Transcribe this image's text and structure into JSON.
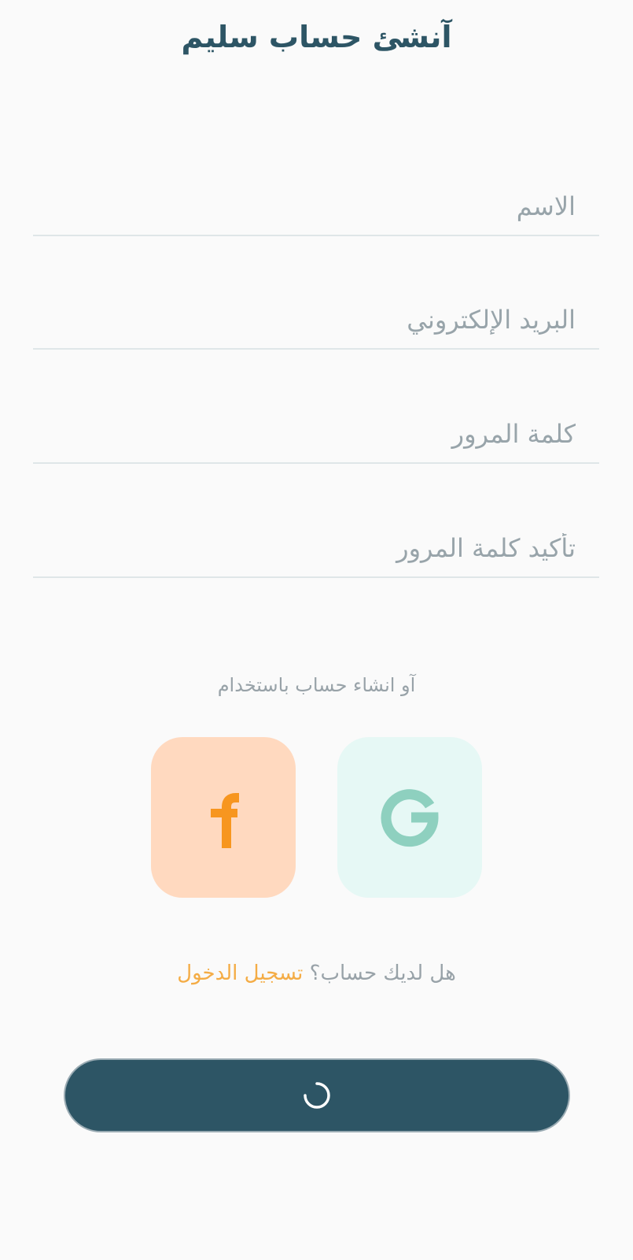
{
  "header": {
    "title": "آنشئ حساب سليم"
  },
  "form": {
    "name_placeholder": "الاسم",
    "email_placeholder": "البريد الإلكتروني",
    "password_placeholder": "كلمة المرور",
    "confirm_password_placeholder": "تأكيد كلمة المرور"
  },
  "social": {
    "or_text": "آو انشاء حساب باستخدام",
    "google_icon": "google-icon",
    "facebook_icon": "facebook-icon",
    "google_color": "#8ed0bf",
    "facebook_color": "#f7961f"
  },
  "login": {
    "prompt": "هل لديك حساب؟",
    "link": "تسجيل الدخول"
  },
  "submit": {
    "state": "loading",
    "spinner_icon": "loading-spinner-icon"
  },
  "colors": {
    "primary": "#2d5565",
    "accent": "#f4ac45",
    "background": "#fafafa"
  }
}
